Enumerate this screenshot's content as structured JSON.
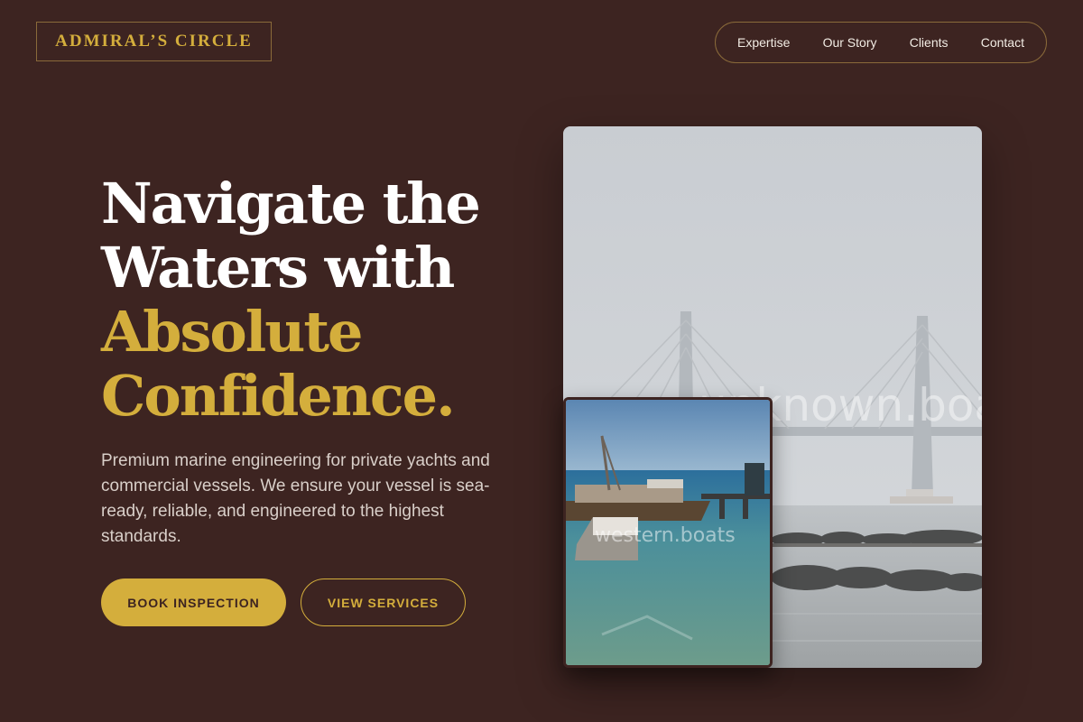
{
  "brand": {
    "logo_text": "ADMIRAL’S CIRCLE"
  },
  "nav": {
    "items": [
      {
        "label": "Expertise"
      },
      {
        "label": "Our Story"
      },
      {
        "label": "Clients"
      },
      {
        "label": "Contact"
      }
    ]
  },
  "hero": {
    "title_line1": "Navigate the",
    "title_line2": "Waters with",
    "title_accent_line1": "Absolute",
    "title_accent_line2": "Confidence.",
    "subtitle": "Premium marine engineering for private yachts and commercial vessels. We ensure your vessel is sea-ready, reliable, and engineered to the highest standards.",
    "primary_cta": "BOOK INSPECTION",
    "secondary_cta": "VIEW SERVICES"
  },
  "images": {
    "main_watermark": "unknown.boats",
    "inset_watermark": "western.boats"
  },
  "colors": {
    "background": "#3d2421",
    "accent": "#d4ae3c",
    "text": "#ffffff"
  }
}
